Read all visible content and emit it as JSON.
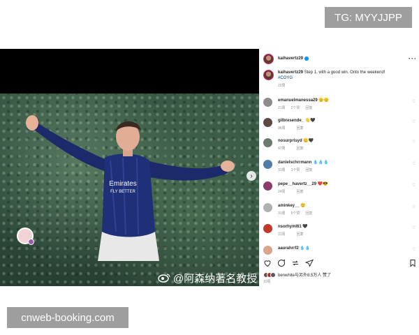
{
  "overlay": {
    "tg_label": "TG: MYYJJPP",
    "site_label": "cnweb-booking.com"
  },
  "photo": {
    "jersey_sponsor": "Emirates FLY BETTER",
    "weibo_watermark": "@阿森纳著名教授"
  },
  "post": {
    "username": "kaihavertz29",
    "caption": "Step 1, with a good win. Onto the weekend!",
    "hashtag": "#COYG",
    "caption_time": "22周"
  },
  "comments": [
    {
      "user": "emanuelmanessa29",
      "text": "🫡🫡",
      "time": "21周",
      "likes": "2个赞",
      "reply": "回复",
      "avatar_color": "#8c8c8c"
    },
    {
      "user": "gilbresende_",
      "text": "👋🖤",
      "time": "96周",
      "likes": "",
      "reply": "回复",
      "avatar_color": "#5a4a42"
    },
    {
      "user": "nosurprisyd",
      "text": "🫡🖤",
      "time": "47周",
      "likes": "",
      "reply": "回复",
      "avatar_color": "#6b7a6a"
    },
    {
      "user": "danielschrrmann",
      "text": "💧💧💧",
      "time": "31周",
      "likes": "1个赞",
      "reply": "回复",
      "avatar_color": "#4f7fa8"
    },
    {
      "user": "pepe__havertz__29",
      "text": "❤️😎",
      "time": "24周",
      "likes": "",
      "reply": "回复",
      "avatar_color": "#8a3b6b"
    },
    {
      "user": "aminkey__",
      "text": "🙂",
      "time": "31周",
      "likes": "5个赞",
      "reply": "回复",
      "avatar_color": "#b0b0b0"
    },
    {
      "user": "nsorhyml61",
      "text": "🖤",
      "time": "31周",
      "likes": "",
      "reply": "回复",
      "avatar_color": "#c0392b"
    },
    {
      "user": "aaurahrrf2",
      "text": "💧💧",
      "time": "",
      "likes": "",
      "reply": "",
      "avatar_color": "#d9a58c"
    }
  ],
  "liked_by": "benwhite与另外8.5万人 赞了",
  "post_date": "10周"
}
